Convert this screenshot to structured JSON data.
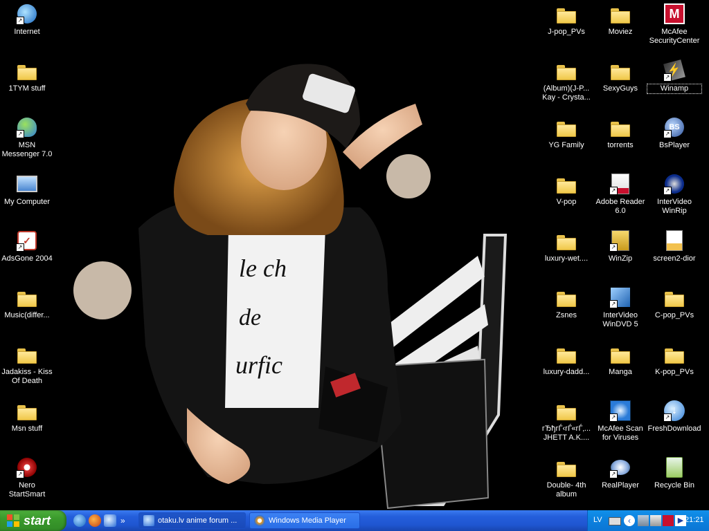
{
  "desktop": {
    "left_icons": [
      {
        "label": "Internet",
        "icon": "internet-explorer-icon",
        "shortcut": true
      },
      {
        "label": "1TYM stuff",
        "icon": "folder-icon",
        "shortcut": false
      },
      {
        "label": "MSN Messenger 7.0",
        "icon": "msn-messenger-icon",
        "shortcut": true
      },
      {
        "label": "My Computer",
        "icon": "my-computer-icon",
        "shortcut": false
      },
      {
        "label": "AdsGone 2004",
        "icon": "adsgone-icon",
        "shortcut": true
      },
      {
        "label": "Music(differ...",
        "icon": "folder-icon",
        "shortcut": false
      },
      {
        "label": "Jadakiss - Kiss Of Death",
        "icon": "folder-icon",
        "shortcut": false
      },
      {
        "label": "Msn stuff",
        "icon": "folder-icon",
        "shortcut": false
      },
      {
        "label": "Nero StartSmart",
        "icon": "nero-icon",
        "shortcut": true
      }
    ],
    "right_col1": [
      {
        "label": "J-pop_PVs",
        "icon": "folder-icon"
      },
      {
        "label": "(Album)(J-P... Kay - Crysta...",
        "icon": "folder-icon"
      },
      {
        "label": "YG Family",
        "icon": "folder-icon"
      },
      {
        "label": "V-pop",
        "icon": "folder-icon"
      },
      {
        "label": "luxury-wet....",
        "icon": "folder-icon"
      },
      {
        "label": "Zsnes",
        "icon": "folder-icon"
      },
      {
        "label": "luxury-dadd...",
        "icon": "folder-icon"
      },
      {
        "label": "гЂђгЃ‹гЃ«гЃ‚... JHETT A.K....",
        "icon": "folder-icon"
      },
      {
        "label": "Double- 4th album",
        "icon": "folder-icon"
      }
    ],
    "right_col2": [
      {
        "label": "Moviez",
        "icon": "folder-icon"
      },
      {
        "label": "SexyGuys",
        "icon": "folder-icon"
      },
      {
        "label": "torrents",
        "icon": "folder-icon"
      },
      {
        "label": "Adobe Reader 6.0",
        "icon": "adobe-reader-icon"
      },
      {
        "label": "WinZip",
        "icon": "winzip-icon"
      },
      {
        "label": "InterVideo WinDVD 5",
        "icon": "windvd-icon"
      },
      {
        "label": "Manga",
        "icon": "folder-icon"
      },
      {
        "label": "McAfee Scan for Viruses",
        "icon": "mcafee-scan-icon"
      },
      {
        "label": "RealPlayer",
        "icon": "realplayer-icon"
      }
    ],
    "right_col3": [
      {
        "label": "McAfee SecurityCenter",
        "icon": "mcafee-icon"
      },
      {
        "label": "Winamp",
        "icon": "winamp-icon"
      },
      {
        "label": "BsPlayer",
        "icon": "bsplayer-icon"
      },
      {
        "label": "InterVideo WinRip",
        "icon": "winrip-icon"
      },
      {
        "label": "screen2-dior",
        "icon": "image-file-icon"
      },
      {
        "label": "C-pop_PVs",
        "icon": "folder-icon"
      },
      {
        "label": "K-pop_PVs",
        "icon": "folder-icon"
      },
      {
        "label": "FreshDownload",
        "icon": "freshdownload-icon"
      },
      {
        "label": "Recycle Bin",
        "icon": "recycle-bin-icon"
      }
    ]
  },
  "taskbar": {
    "start_label": "start",
    "tasks": [
      {
        "label": "otaku.lv anime forum ...",
        "icon": "internet-explorer-icon"
      },
      {
        "label": "Windows Media Player",
        "icon": "media-player-icon"
      }
    ],
    "quick_launch_more": "»",
    "tray": {
      "language": "LV",
      "clock": "21:21"
    }
  }
}
